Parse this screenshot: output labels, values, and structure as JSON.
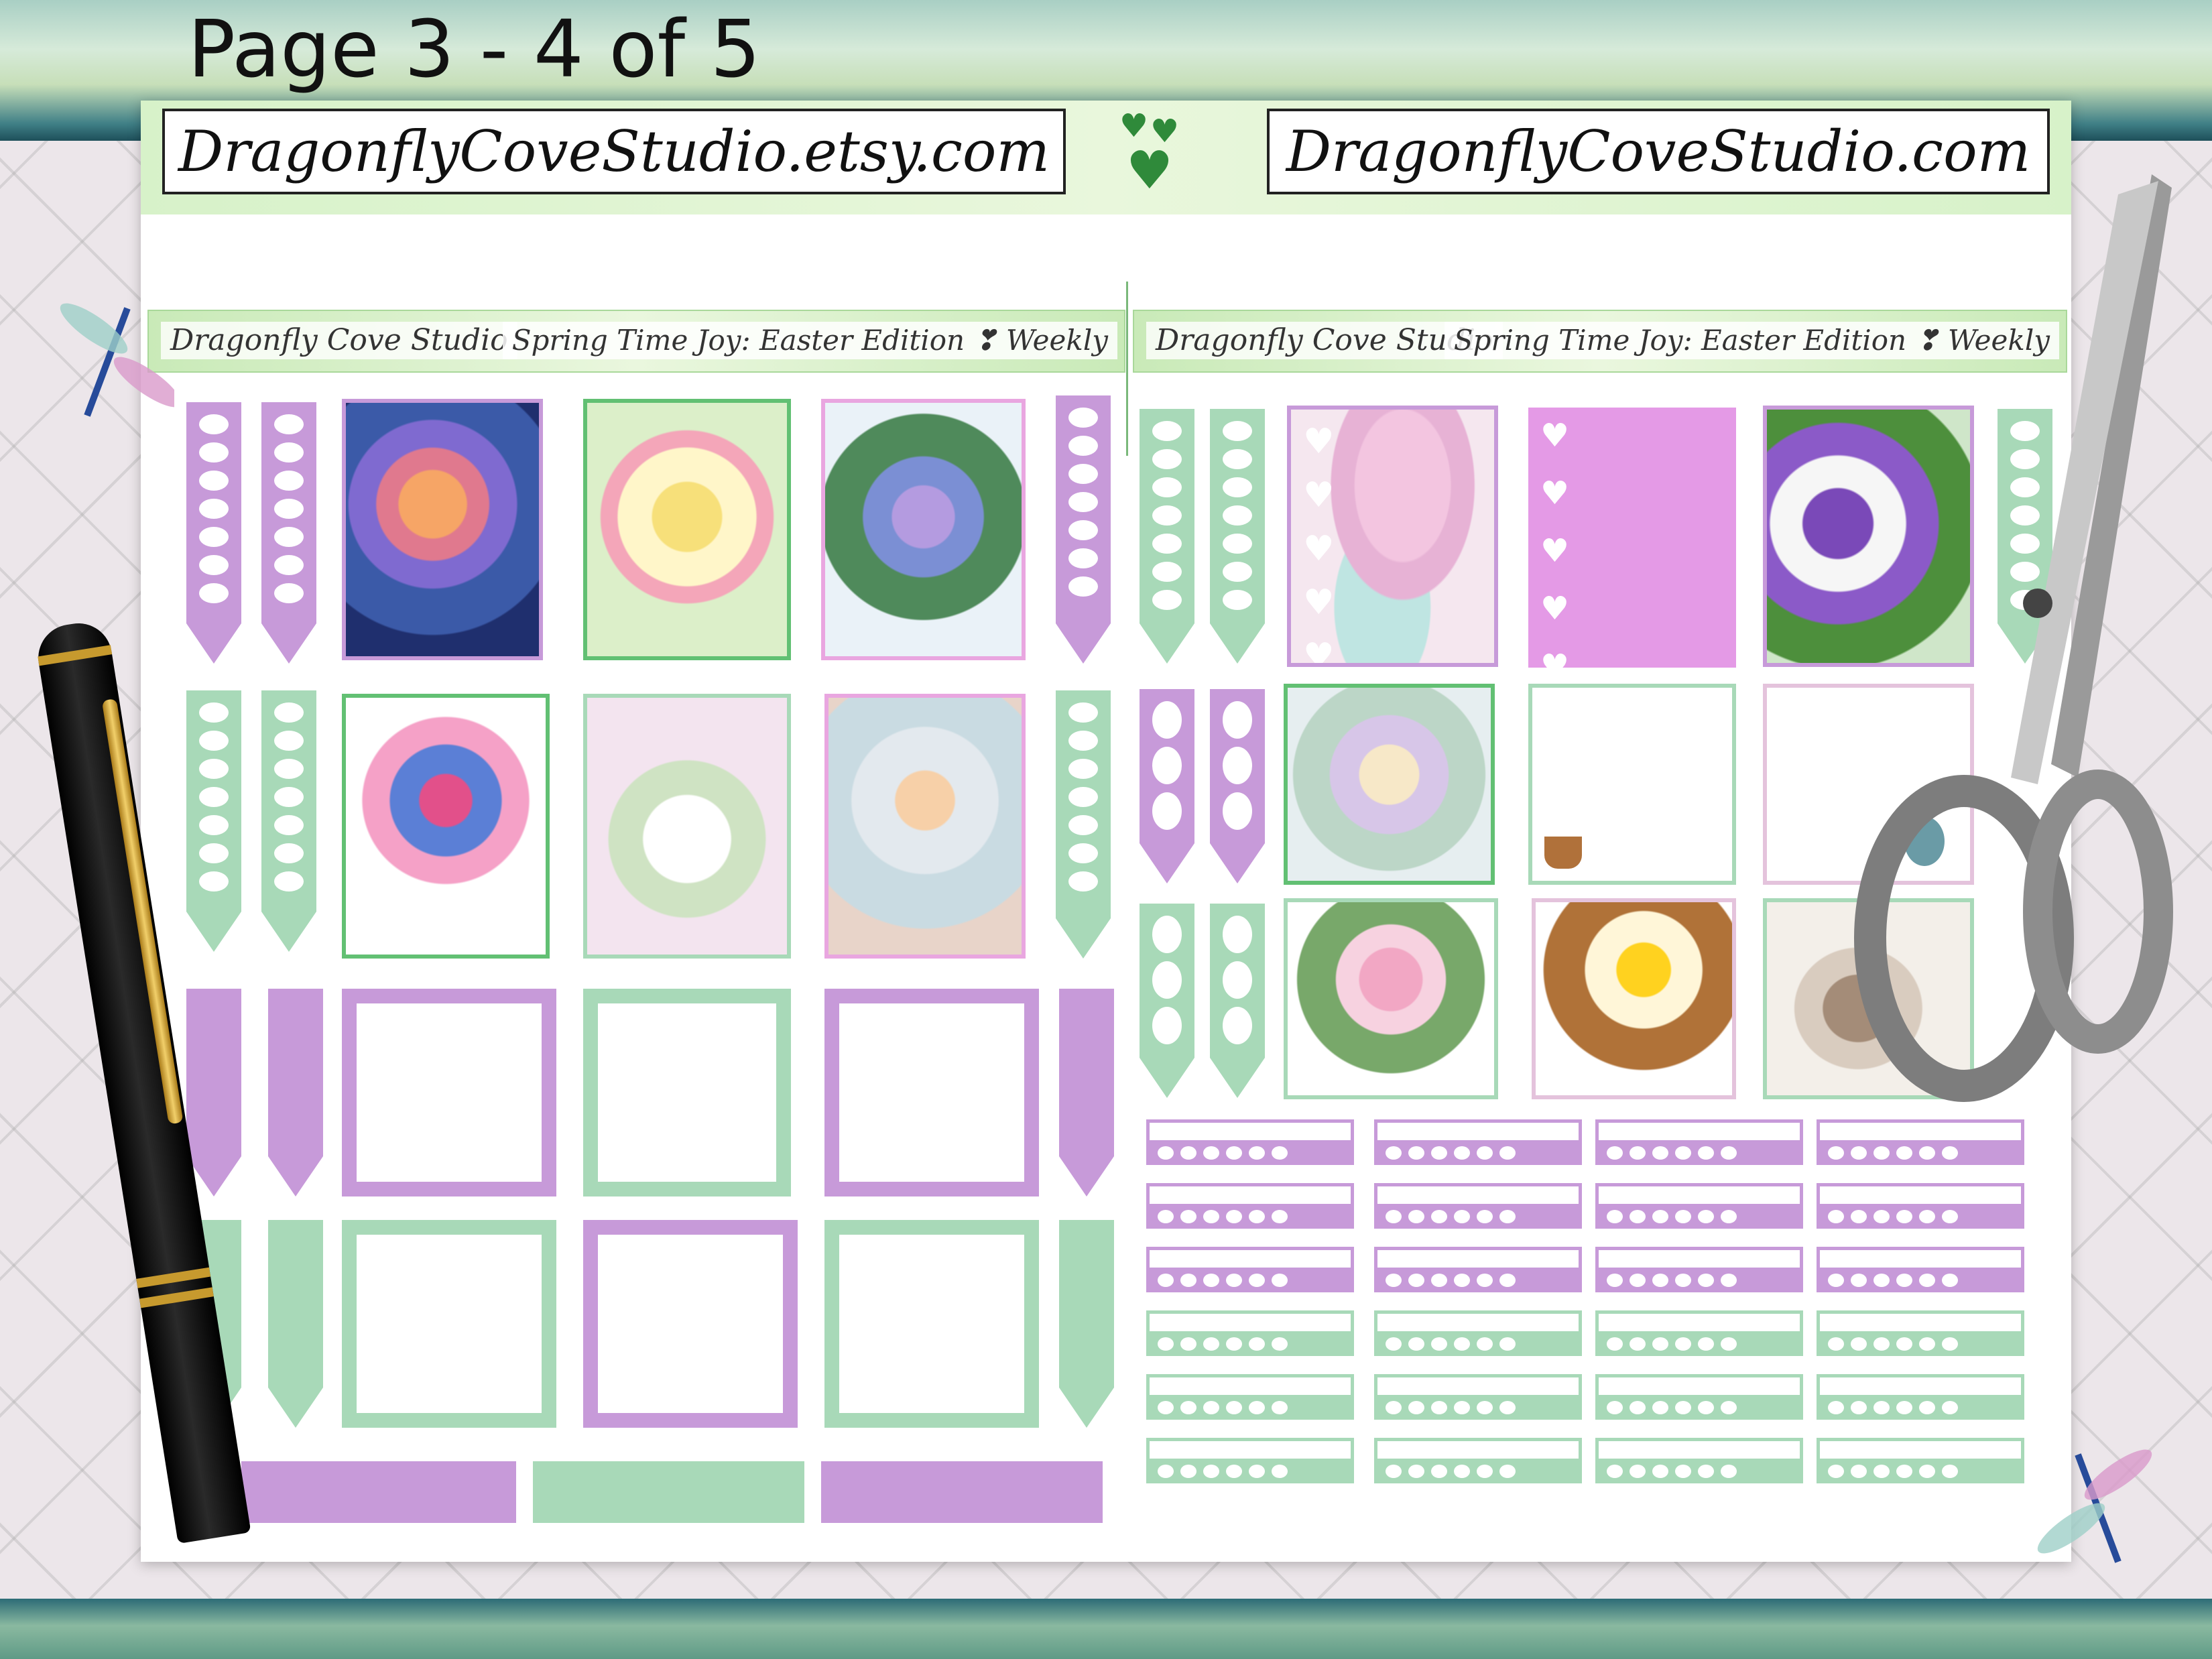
{
  "page_title": "Page 3 - 4 of 5",
  "etsy_url": "DragonflyCoveStudio.etsy.com",
  "site_url": "DragonflyCoveStudio.com",
  "header_left": {
    "studio": "Dragonfly Cove Studio",
    "kit": "Spring Time Joy: Easter Edition ❣ Weekly"
  },
  "header_right": {
    "studio": "Dragonfly Cove Studio",
    "kit": "Spring Time Joy: Easter Edition ❣ Weekly"
  },
  "colors": {
    "lavender": "#c79ad9",
    "mint": "#a8d9b8",
    "green_frame": "#62c073",
    "pink_frame": "#e9a6e0"
  },
  "icons": [
    "heart-icon",
    "dragonfly-icon",
    "pen-icon",
    "scissors-icon"
  ]
}
